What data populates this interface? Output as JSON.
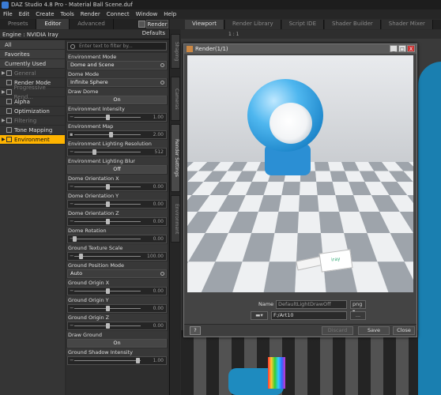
{
  "titlebar": {
    "title": "DAZ Studio 4.8 Pro - Material Ball Scene.duf"
  },
  "menu": [
    "File",
    "Edit",
    "Create",
    "Tools",
    "Render",
    "Connect",
    "Window",
    "Help"
  ],
  "left_tabs": [
    "Presets",
    "Editor",
    "Advanced"
  ],
  "left_tabs_active": "Editor",
  "render_button": "Render",
  "engine": {
    "label": "Engine :",
    "value": "NVIDIA Iray",
    "defaults": "Defaults"
  },
  "categories": {
    "top": [
      "All",
      "Favorites",
      "Currently Used"
    ],
    "sub": [
      {
        "label": "General",
        "disabled": true
      },
      {
        "label": "Render Mode",
        "disabled": false
      },
      {
        "label": "Progressive Rend...",
        "disabled": true
      },
      {
        "label": "Alpha",
        "disabled": false
      },
      {
        "label": "Optimization",
        "disabled": false
      },
      {
        "label": "Filtering",
        "disabled": true
      },
      {
        "label": "Tone Mapping",
        "disabled": false
      },
      {
        "label": "Environment",
        "disabled": false,
        "selected": true
      }
    ]
  },
  "filter_placeholder": "Enter text to filter by...",
  "properties": {
    "environment_mode": {
      "label": "Environment Mode",
      "value": "Dome and Scene"
    },
    "dome_mode": {
      "label": "Dome Mode",
      "value": "Infinite Sphere"
    },
    "draw_dome": {
      "label": "Draw Dome",
      "value": "On"
    },
    "environment_intensity": {
      "label": "Environment Intensity",
      "value": "1.00",
      "level": 0.5
    },
    "environment_map": {
      "label": "Environment Map",
      "value": "2.00",
      "level": 0.55
    },
    "environment_lighting_resolution": {
      "label": "Environment Lighting Resolution",
      "value": "512",
      "level": 0.3
    },
    "environment_lighting_blur": {
      "label": "Environment Lighting Blur",
      "value": "Off"
    },
    "dome_orientation_x": {
      "label": "Dome Orientation X",
      "value": "0.00",
      "level": 0.5
    },
    "dome_orientation_y": {
      "label": "Dome Orientation Y",
      "value": "0.00",
      "level": 0.5
    },
    "dome_orientation_z": {
      "label": "Dome Orientation Z",
      "value": "0.00",
      "level": 0.5
    },
    "dome_rotation": {
      "label": "Dome Rotation",
      "value": "0.00",
      "level": 0.0
    },
    "ground_texture_scale": {
      "label": "Ground Texture Scale",
      "value": "100.00",
      "level": 0.1
    },
    "ground_position_mode": {
      "label": "Ground Position Mode",
      "value": "Auto"
    },
    "ground_origin_x": {
      "label": "Ground Origin X",
      "value": "0.00",
      "level": 0.5
    },
    "ground_origin_y": {
      "label": "Ground Origin Y",
      "value": "0.00",
      "level": 0.5
    },
    "ground_origin_z": {
      "label": "Ground Origin Z",
      "value": "0.00",
      "level": 0.5
    },
    "draw_ground": {
      "label": "Draw Ground",
      "value": "On"
    },
    "ground_shadow_intensity": {
      "label": "Ground Shadow Intensity",
      "value": "1.00",
      "level": 0.95
    }
  },
  "side_tabs": [
    "Shaping",
    "Cameras",
    "Render Settings",
    "Environment"
  ],
  "side_tab_active": "Render Settings",
  "viewport_tabs": [
    "Viewport",
    "Render Library",
    "Script IDE",
    "Shader Builder",
    "Shader Mixer"
  ],
  "viewport_tab_active": "Viewport",
  "viewport_ratio": "1 : 1",
  "render_window": {
    "title": "Render(1/1)",
    "min": "_",
    "max": "□",
    "close": "X",
    "card_text": "iray",
    "name_label": "Name",
    "name_value": "DefaultLightDrawOff",
    "format": "png",
    "path": "F:/Art10",
    "browse": "...",
    "help": "?",
    "discard": "Discard",
    "save": "Save",
    "close_btn": "Close"
  }
}
